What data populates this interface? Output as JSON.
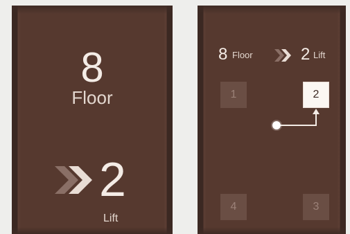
{
  "left_panel": {
    "floor_number": "8",
    "floor_label": "Floor",
    "lift_number": "2",
    "lift_label": "Lift",
    "arrow_icon": "double-chevron-right-icon"
  },
  "right_panel": {
    "summary": {
      "floor_number": "8",
      "floor_label": "Floor",
      "lift_number": "2",
      "lift_label": "Lift",
      "arrow_icon": "double-chevron-right-icon"
    },
    "lifts": [
      {
        "label": "1",
        "active": false
      },
      {
        "label": "2",
        "active": true
      },
      {
        "label": "4",
        "active": false
      },
      {
        "label": "3",
        "active": false
      }
    ],
    "route_icons": [
      "start-dot-icon",
      "route-arrow-icon"
    ]
  },
  "colors": {
    "panel_bg": "#56392f",
    "panel_edge": "#3b2822",
    "text_light": "#f4ece6",
    "inactive_box": "#6a4e44",
    "active_box": "#fbf7f3",
    "page_bg": "#eeeeec"
  }
}
